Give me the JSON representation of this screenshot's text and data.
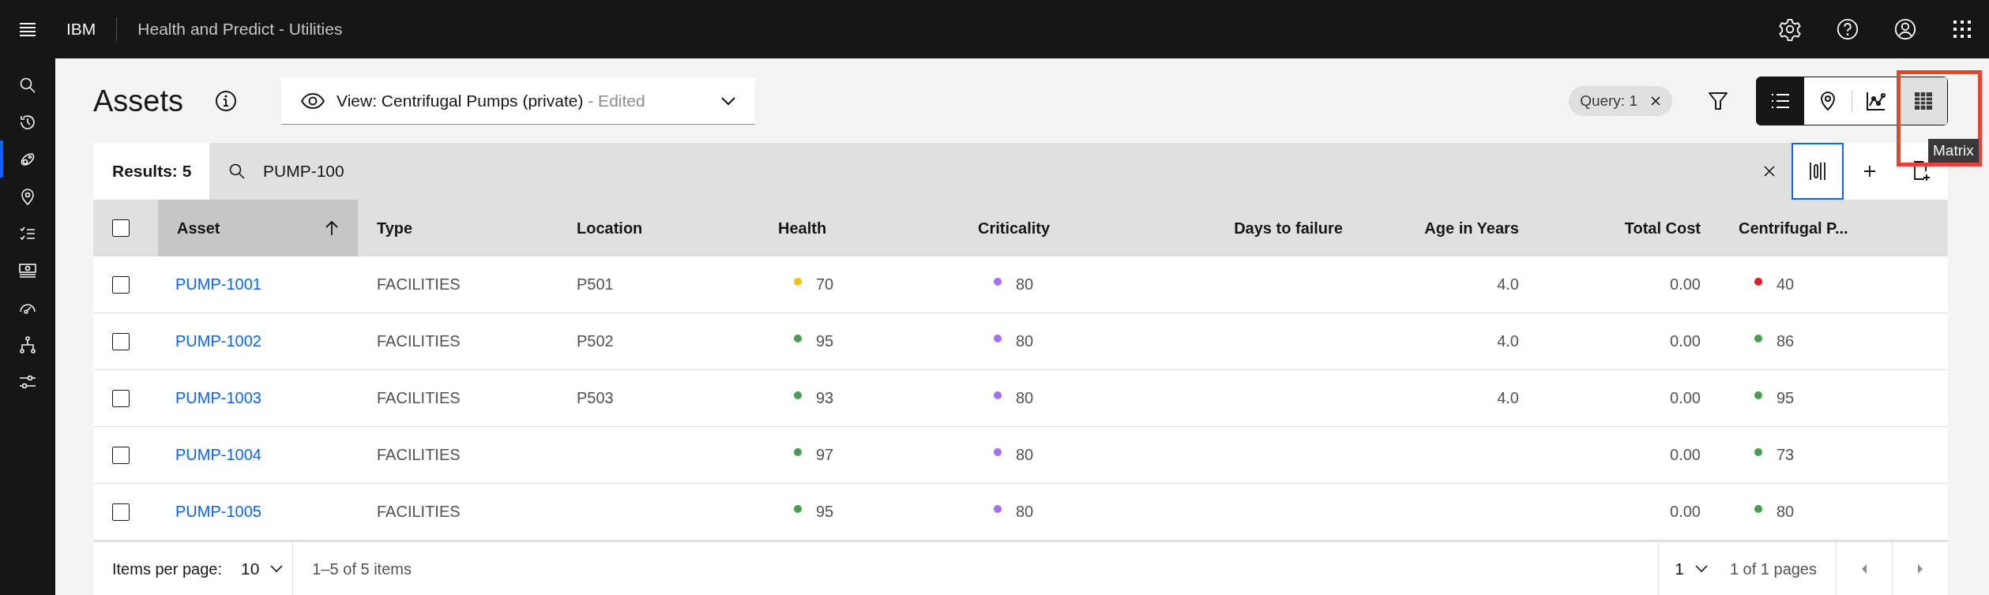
{
  "header": {
    "brand": "IBM",
    "product": "Health and Predict - Utilities"
  },
  "side_nav": {
    "items": [
      {
        "selected": false
      },
      {
        "selected": false
      },
      {
        "selected": true
      },
      {
        "selected": false
      },
      {
        "selected": false
      },
      {
        "selected": false
      },
      {
        "selected": false
      },
      {
        "selected": false
      },
      {
        "selected": false
      }
    ]
  },
  "page": {
    "title": "Assets"
  },
  "view_selector": {
    "label": "View: Centrifugal Pumps (private)",
    "status": "- Edited"
  },
  "query_tag": {
    "label": "Query: 1"
  },
  "view_switcher": [
    {
      "selected": true,
      "hovered": false,
      "highlighted": false
    },
    {
      "selected": false,
      "hovered": false,
      "highlighted": false
    },
    {
      "selected": false,
      "hovered": false,
      "highlighted": false
    },
    {
      "selected": false,
      "hovered": true,
      "highlighted": true
    }
  ],
  "tooltip": {
    "text": "Matrix"
  },
  "toolbar": {
    "results": "Results: 5",
    "search": {
      "value": "PUMP-100"
    }
  },
  "table": {
    "select_all_checked": false,
    "columns": [
      {
        "label": "Asset",
        "kind": "link",
        "sorted": true
      },
      {
        "label": "Type",
        "kind": "text",
        "sorted": false
      },
      {
        "label": "Location",
        "kind": "text",
        "sorted": false
      },
      {
        "label": "Health",
        "kind": "status",
        "sorted": false
      },
      {
        "label": "Criticality",
        "kind": "status",
        "sorted": false
      },
      {
        "label": "Days to failure",
        "kind": "number",
        "sorted": false
      },
      {
        "label": "Age in Years",
        "kind": "number",
        "sorted": false
      },
      {
        "label": "Total Cost",
        "kind": "number",
        "sorted": false
      },
      {
        "label": "Centrifugal P...",
        "kind": "status",
        "sorted": false
      }
    ],
    "rows": [
      {
        "checked": false,
        "cells": [
          {
            "text": "PUMP-1001"
          },
          {
            "text": "FACILITIES"
          },
          {
            "text": "P501"
          },
          {
            "text": "70",
            "color": "#f1c21b"
          },
          {
            "text": "80",
            "color": "#a56eff"
          },
          {},
          {
            "text": "4.0"
          },
          {
            "text": "0.00"
          },
          {
            "text": "40",
            "color": "#da1e28"
          }
        ]
      },
      {
        "checked": false,
        "cells": [
          {
            "text": "PUMP-1002"
          },
          {
            "text": "FACILITIES"
          },
          {
            "text": "P502"
          },
          {
            "text": "95",
            "color": "#4a9e50"
          },
          {
            "text": "80",
            "color": "#a56eff"
          },
          {},
          {
            "text": "4.0"
          },
          {
            "text": "0.00"
          },
          {
            "text": "86",
            "color": "#4a9e50"
          }
        ]
      },
      {
        "checked": false,
        "cells": [
          {
            "text": "PUMP-1003"
          },
          {
            "text": "FACILITIES"
          },
          {
            "text": "P503"
          },
          {
            "text": "93",
            "color": "#4a9e50"
          },
          {
            "text": "80",
            "color": "#a56eff"
          },
          {},
          {
            "text": "4.0"
          },
          {
            "text": "0.00"
          },
          {
            "text": "95",
            "color": "#4a9e50"
          }
        ]
      },
      {
        "checked": false,
        "cells": [
          {
            "text": "PUMP-1004"
          },
          {
            "text": "FACILITIES"
          },
          {},
          {
            "text": "97",
            "color": "#4a9e50"
          },
          {
            "text": "80",
            "color": "#a56eff"
          },
          {},
          {},
          {
            "text": "0.00"
          },
          {
            "text": "73",
            "color": "#4a9e50"
          }
        ]
      },
      {
        "checked": false,
        "cells": [
          {
            "text": "PUMP-1005"
          },
          {
            "text": "FACILITIES"
          },
          {},
          {
            "text": "95",
            "color": "#4a9e50"
          },
          {
            "text": "80",
            "color": "#a56eff"
          },
          {},
          {},
          {
            "text": "0.00"
          },
          {
            "text": "80",
            "color": "#4a9e50"
          }
        ]
      }
    ]
  },
  "pagination": {
    "items_per_page_label": "Items per page:",
    "page_size": "10",
    "range": "1–5 of 5 items",
    "page": "1",
    "pages": "1 of 1 pages"
  }
}
